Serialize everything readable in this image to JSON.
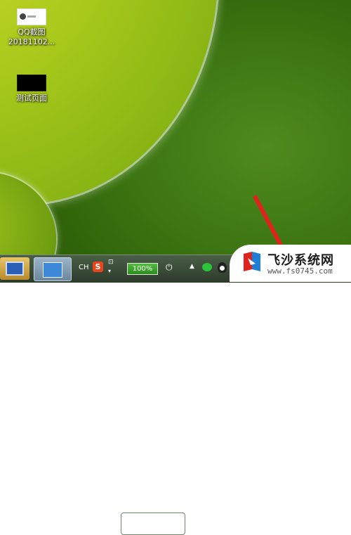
{
  "desktop": {
    "icons": [
      {
        "label_line1": "QQ截图",
        "label_line2": "20181102..."
      },
      {
        "label_line1": "测试页面",
        "label_line2": ""
      }
    ]
  },
  "taskbar": {
    "language": "CH",
    "ime_icon": "S",
    "battery_text": "100%"
  },
  "watermark": {
    "title": "飞沙系统网",
    "url": "www.fs0745.com"
  }
}
